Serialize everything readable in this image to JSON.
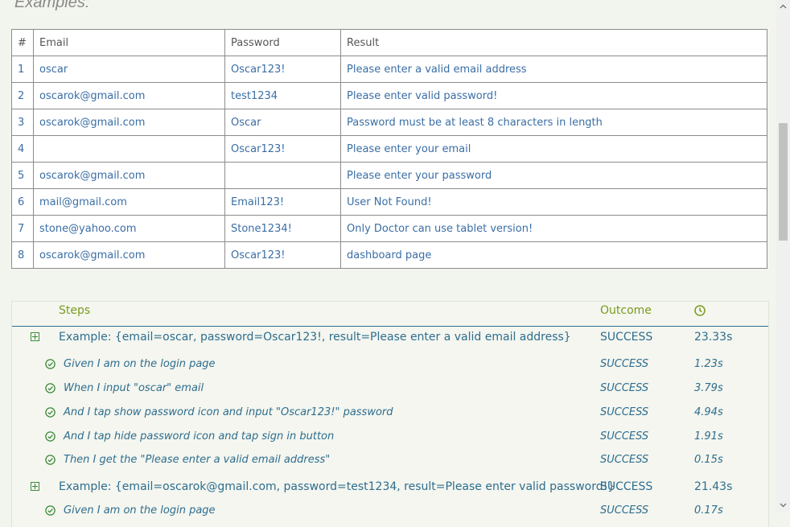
{
  "examples": {
    "title": "Examples:",
    "headers": [
      "#",
      "Email",
      "Password",
      "Result"
    ],
    "rows": [
      {
        "n": "1",
        "email": "oscar",
        "password": "Oscar123!",
        "result": "Please enter a valid email address"
      },
      {
        "n": "2",
        "email": "oscarok@gmail.com",
        "password": "test1234",
        "result": "Please enter valid password!"
      },
      {
        "n": "3",
        "email": "oscarok@gmail.com",
        "password": "Oscar",
        "result": "Password must be at least 8 characters in length"
      },
      {
        "n": "4",
        "email": "",
        "password": "Oscar123!",
        "result": "Please enter your email"
      },
      {
        "n": "5",
        "email": "oscarok@gmail.com",
        "password": "",
        "result": "Please enter your password"
      },
      {
        "n": "6",
        "email": "mail@gmail.com",
        "password": "Email123!",
        "result": "User Not Found!"
      },
      {
        "n": "7",
        "email": "stone@yahoo.com",
        "password": "Stone1234!",
        "result": "Only Doctor can use tablet version!"
      },
      {
        "n": "8",
        "email": "oscarok@gmail.com",
        "password": "Oscar123!",
        "result": "dashboard page"
      }
    ]
  },
  "steps": {
    "header_steps": "Steps",
    "header_outcome": "Outcome",
    "clock_icon": "clock-icon",
    "rows": [
      {
        "kind": "example",
        "text": "Example: {email=oscar, password=Oscar123!, result=Please enter a valid email address}",
        "outcome": "SUCCESS",
        "duration": "23.33s"
      },
      {
        "kind": "step",
        "text": "Given I am on the login page",
        "outcome": "SUCCESS",
        "duration": "1.23s"
      },
      {
        "kind": "step",
        "text": "When I input \"oscar\" email",
        "outcome": "SUCCESS",
        "duration": "3.79s"
      },
      {
        "kind": "step",
        "text": "And I tap show password icon and input \"Oscar123!\" password",
        "outcome": "SUCCESS",
        "duration": "4.94s"
      },
      {
        "kind": "step",
        "text": "And I tap hide password icon and tap sign in button",
        "outcome": "SUCCESS",
        "duration": "1.91s"
      },
      {
        "kind": "step",
        "text": "Then I get the \"Please enter a valid email address\"",
        "outcome": "SUCCESS",
        "duration": "0.15s"
      },
      {
        "kind": "example",
        "text": "Example: {email=oscarok@gmail.com, password=test1234, result=Please enter valid password!}",
        "outcome": "SUCCESS",
        "duration": "21.43s"
      },
      {
        "kind": "step",
        "text": "Given I am on the login page",
        "outcome": "SUCCESS",
        "duration": "0.17s"
      }
    ]
  },
  "colors": {
    "accent_green": "#7a9a1f",
    "link_blue": "#2e6d8f",
    "cell_blue": "#3a6ea5",
    "icon_green": "#3a8a3a"
  }
}
